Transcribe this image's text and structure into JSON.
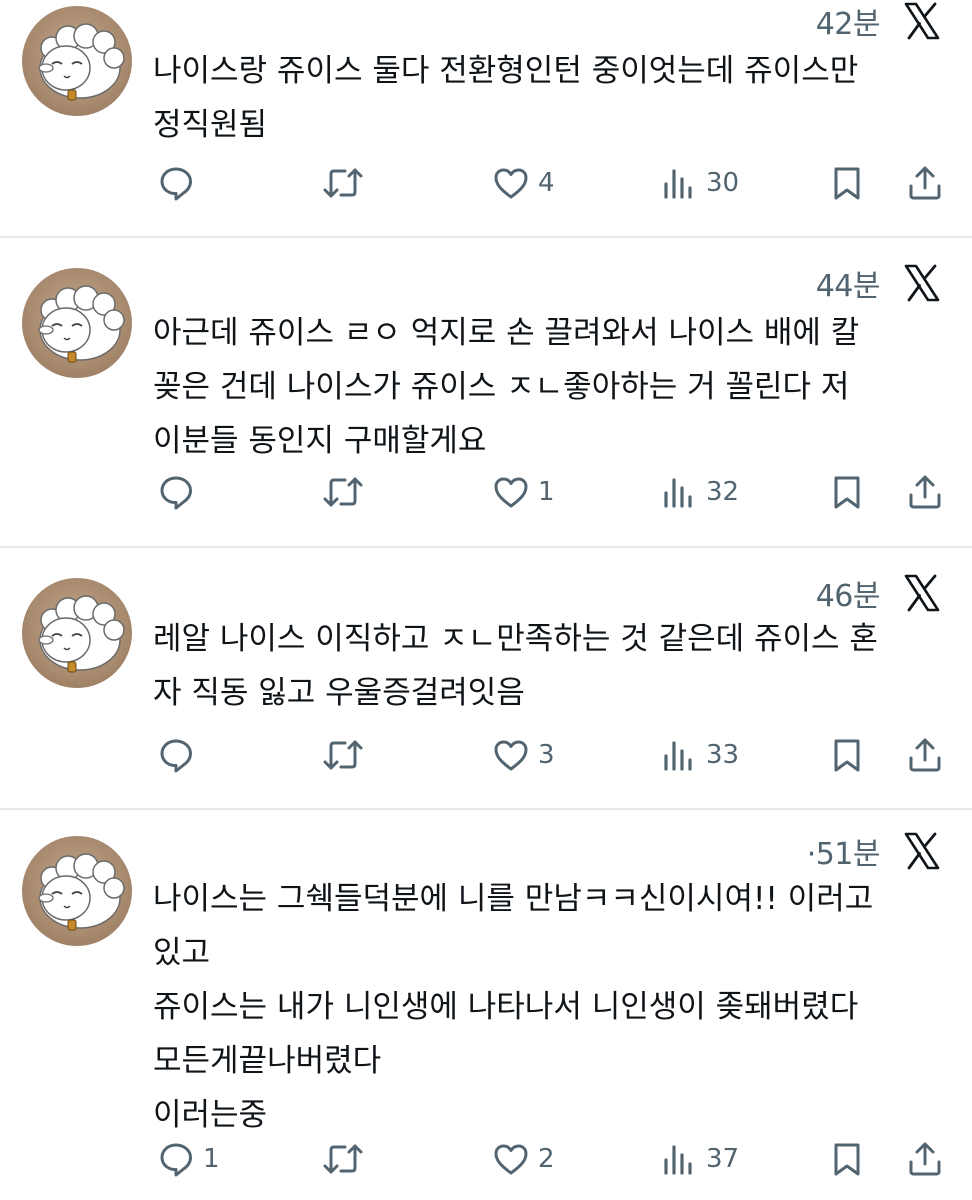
{
  "tweets": [
    {
      "time": "42분",
      "text": "나이스랑 쥬이스 둘다 전환형인턴 중이엇는데 쥬이스만\n정직원됨",
      "replies": "",
      "retweets": "",
      "likes": "4",
      "views": "30"
    },
    {
      "time": "44분",
      "text": "아근데 쥬이스 ㄹㅇ 억지로 손 끌려와서 나이스 배에 칼\n꽂은 건데 나이스가 쥬이스 ㅈㄴ좋아하는 거 꼴린다 저\n이분들 동인지 구매할게요",
      "replies": "",
      "retweets": "",
      "likes": "1",
      "views": "32"
    },
    {
      "time": "46분",
      "text": "레알 나이스 이직하고 ㅈㄴ만족하는 것 같은데 쥬이스 혼\n자 직동 잃고 우울증걸려잇음",
      "replies": "",
      "retweets": "",
      "likes": "3",
      "views": "33"
    },
    {
      "time": "·51분",
      "text": "나이스는 그쉑들덕분에 니를 만남ㅋㅋ신이시여!! 이러고\n있고\n쥬이스는 내가 니인생에 나타나서 니인생이 좆돼버렸다\n모든게끝나버렸다\n이러는중",
      "replies": "1",
      "retweets": "",
      "likes": "2",
      "views": "37"
    }
  ],
  "icons": {
    "reply": "reply-icon",
    "retweet": "retweet-icon",
    "like": "heart-icon",
    "views": "views-icon",
    "bookmark": "bookmark-icon",
    "share": "share-icon",
    "brand": "x-logo-icon",
    "avatar": "sheep-avatar"
  },
  "colors": {
    "text": "#0f1419",
    "muted": "#536471",
    "divider": "#e6e9ec",
    "avatar_bg": "#a88a6e"
  }
}
